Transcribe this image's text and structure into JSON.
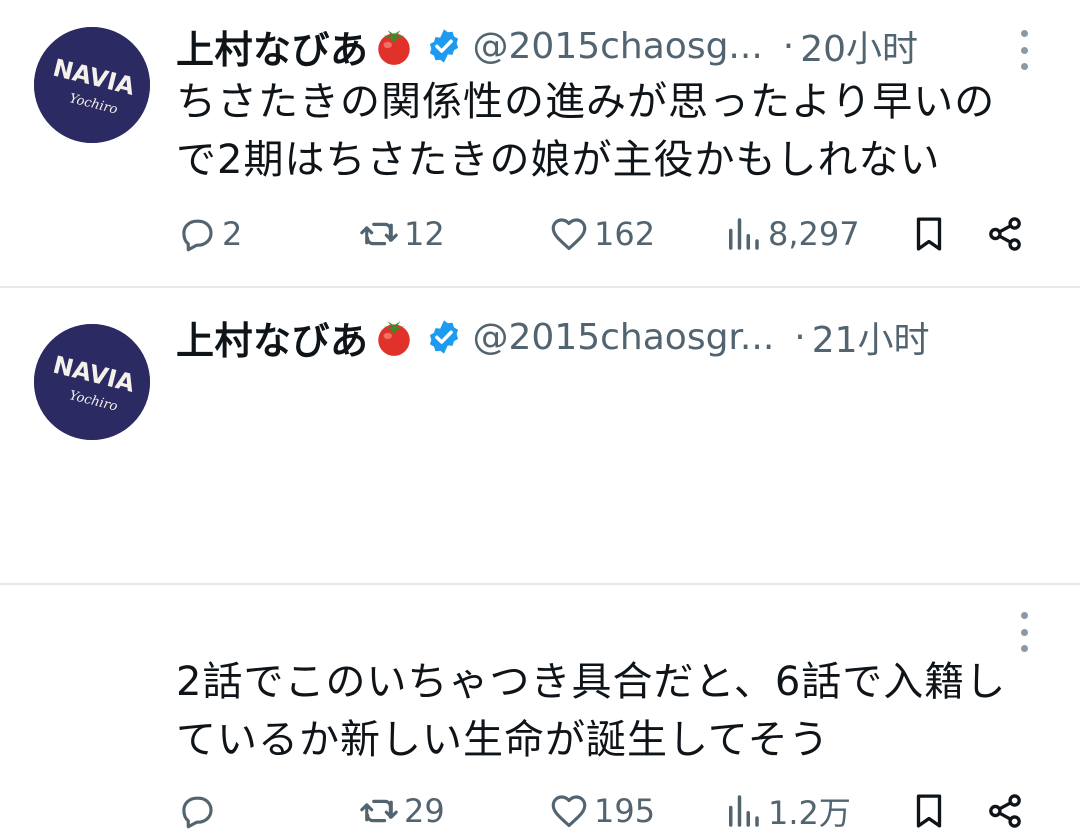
{
  "tweets": [
    {
      "name": "上村なびあ",
      "handle": "@2015chaosg...",
      "dot": "·",
      "time": "20小时",
      "text_lines": [
        "ちさたきの関係性の進みが思ったより早いの",
        "で2期はちさたきの娘が主役かもしれない"
      ],
      "replies": "2",
      "retweets": "12",
      "likes": "162",
      "views": "8,297"
    },
    {
      "name": "上村なびあ",
      "handle": "@2015chaosgr...",
      "dot": "·",
      "time": "21小时",
      "text_lines": [
        "2話でこのいちゃつき具合だと、6話で入籍し",
        "ているか新しい生命が誕生してそう"
      ],
      "replies": "",
      "retweets": "29",
      "likes": "195",
      "views": "1.2万"
    }
  ],
  "avatar": {
    "logo_text": "NAVIA",
    "script_text": "Yochiro"
  },
  "colors": {
    "verified": "#1d9bf0",
    "muted": "#536471",
    "avatar_bg": "#2c2a63",
    "tomato": "#e0322a"
  },
  "icons": {
    "reply": "reply-icon",
    "retweet": "retweet-icon",
    "like": "heart-icon",
    "views": "views-icon",
    "bookmark": "bookmark-icon",
    "share": "share-icon",
    "more": "more-icon",
    "verified": "verified-badge-icon",
    "emoji": "tomato-emoji"
  }
}
